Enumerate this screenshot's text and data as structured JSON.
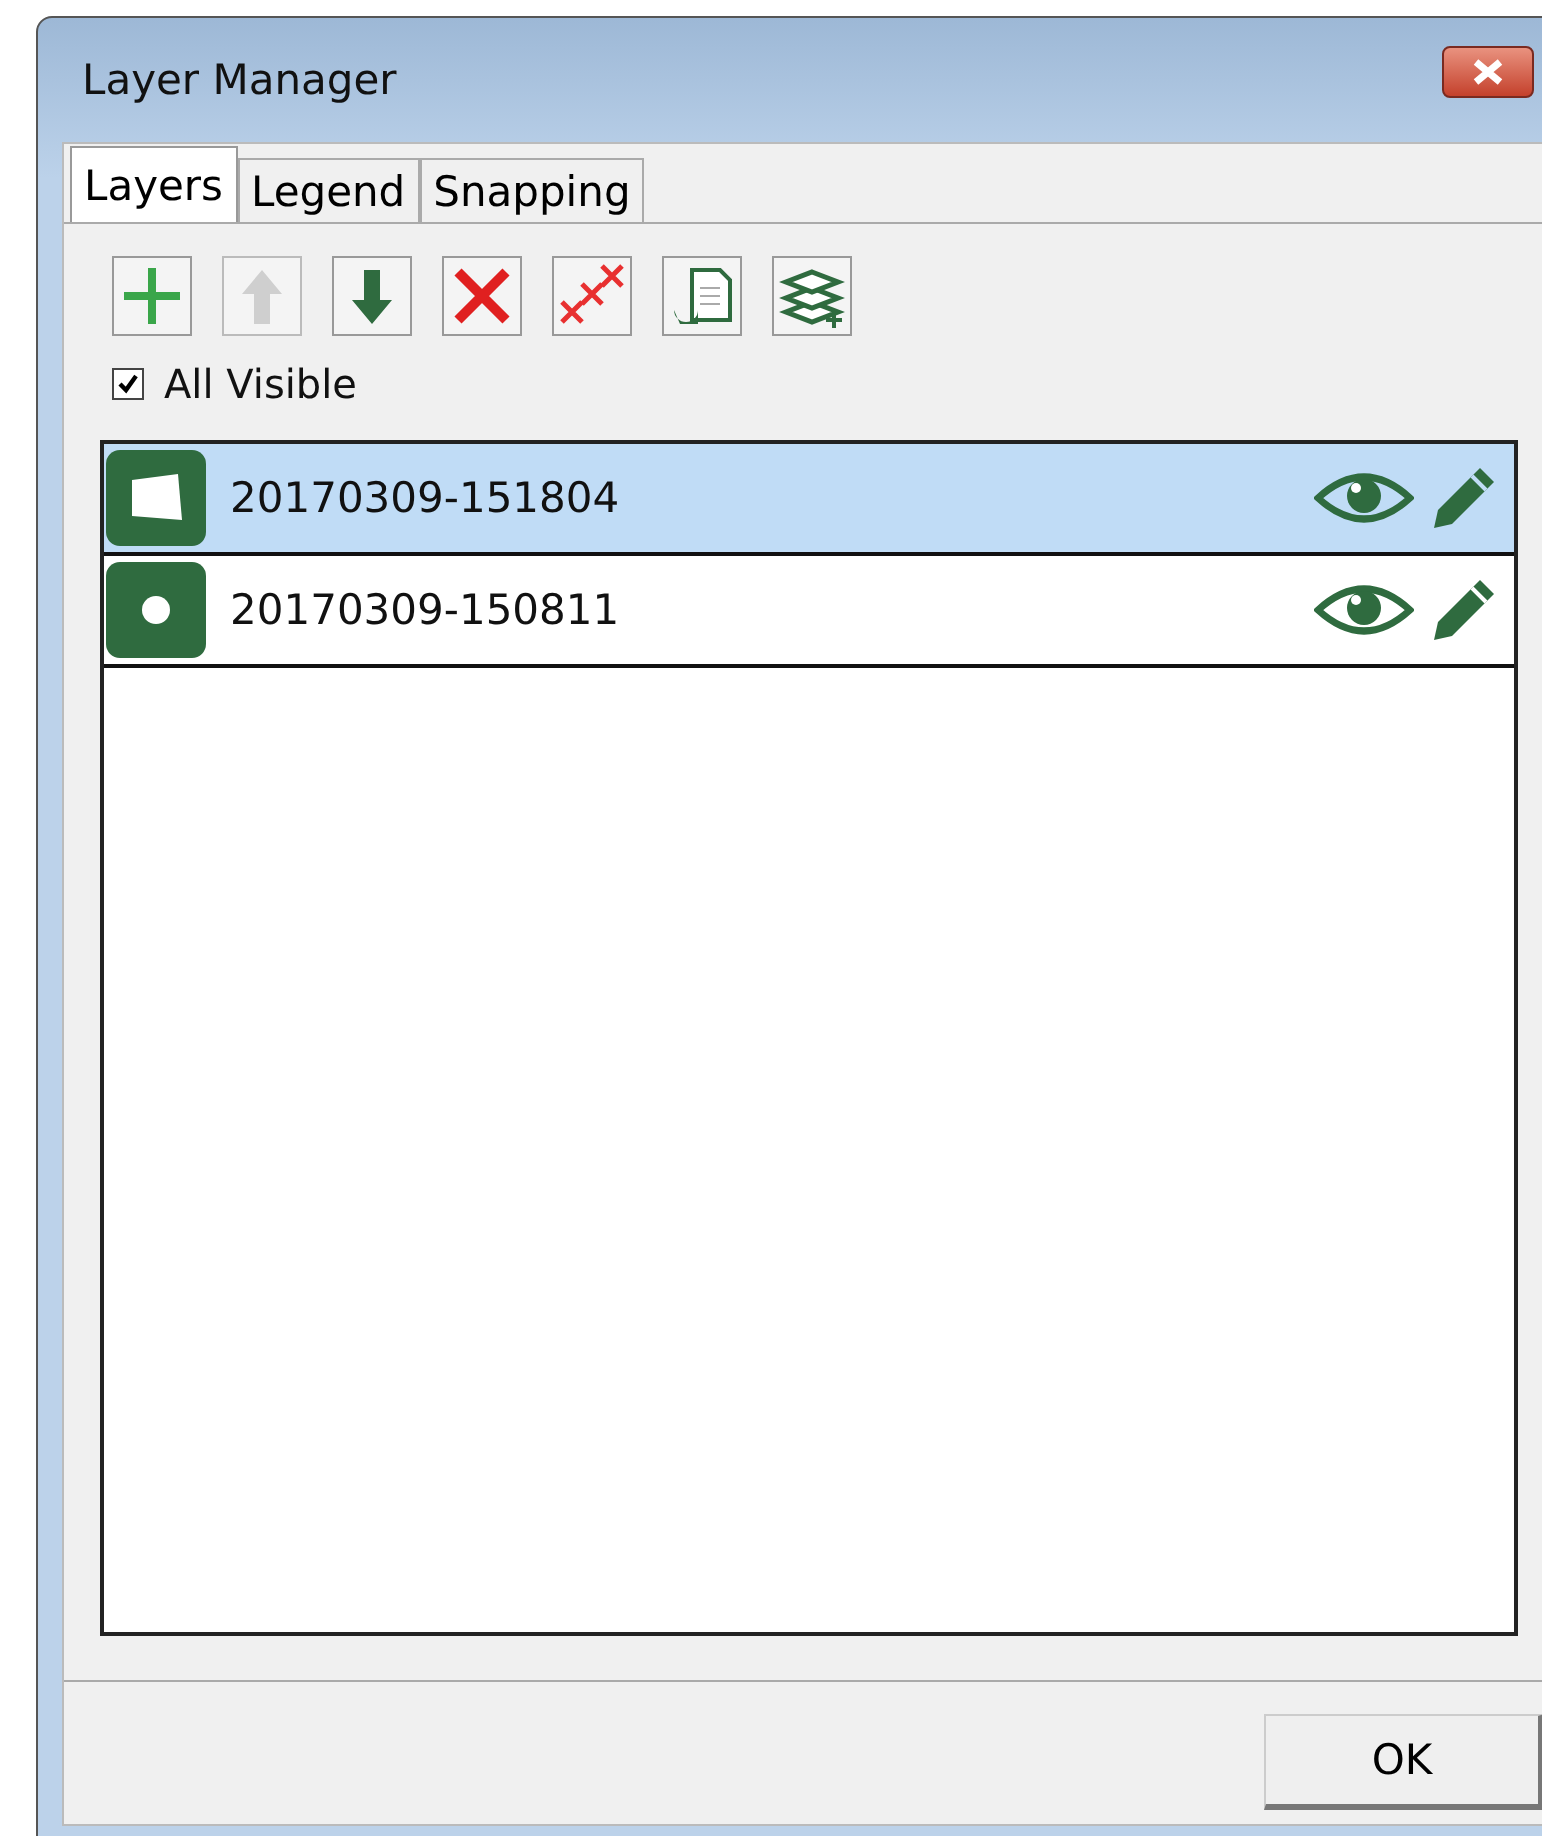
{
  "window": {
    "title": "Layer Manager"
  },
  "tabs": [
    {
      "label": "Layers",
      "selected": true
    },
    {
      "label": "Legend",
      "selected": false
    },
    {
      "label": "Snapping",
      "selected": false
    }
  ],
  "toolbar": [
    {
      "kind": "add",
      "disabled": false
    },
    {
      "kind": "up",
      "disabled": true
    },
    {
      "kind": "down",
      "disabled": false
    },
    {
      "kind": "remove",
      "disabled": false
    },
    {
      "kind": "remove_all",
      "disabled": false
    },
    {
      "kind": "open",
      "disabled": false
    },
    {
      "kind": "layers",
      "disabled": false
    }
  ],
  "all_visible": {
    "label": "All Visible",
    "checked": true
  },
  "layers": [
    {
      "name": "20170309-151804",
      "kind": "polygon",
      "selected": true
    },
    {
      "name": "20170309-150811",
      "kind": "point",
      "selected": false
    }
  ],
  "buttons": [
    "OK"
  ]
}
